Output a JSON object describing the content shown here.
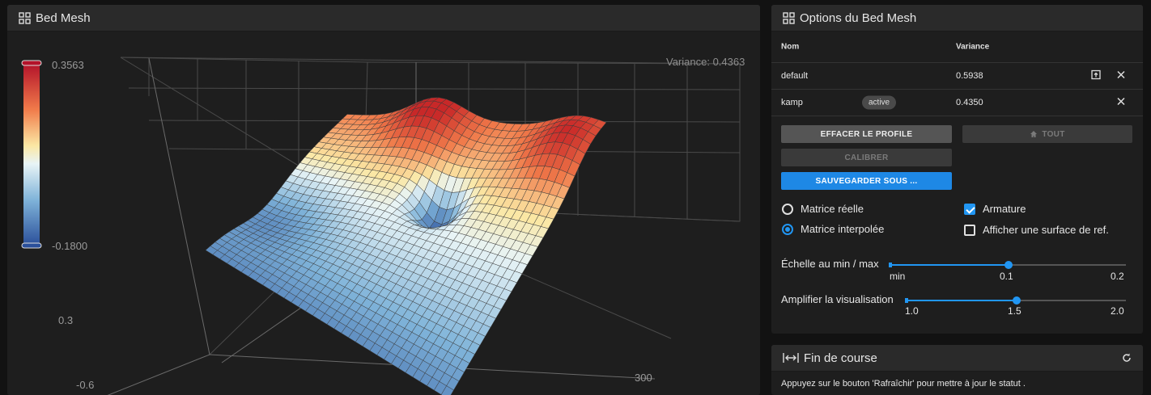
{
  "left_panel": {
    "title": "Bed Mesh",
    "variance": "Variance: 0.4363",
    "scale_max": "0.3563",
    "scale_min": "-0.1800",
    "axis_z_high": "0.3",
    "axis_z_low": "-0.6",
    "axis_x_end": "300"
  },
  "options": {
    "title": "Options du Bed Mesh",
    "col_name": "Nom",
    "col_variance": "Variance",
    "profiles": [
      {
        "name": "default",
        "badge": "",
        "variance": "0.5938"
      },
      {
        "name": "kamp",
        "badge": "active",
        "variance": "0.4350"
      }
    ],
    "btn_clear": "EFFACER LE PROFILE",
    "btn_home": "TOUT",
    "btn_calibrate": "CALIBRER",
    "btn_save": "SAUVEGARDER SOUS ...",
    "radio_real": "Matrice réelle",
    "radio_interp": "Matrice interpolée",
    "cb_wireframe": "Armature",
    "cb_refsurface": "Afficher une surface de ref.",
    "scale_label": "Échelle au min / max",
    "scale_ticks": [
      "min",
      "0.1",
      "0.2"
    ],
    "scale_value": 0.1,
    "amp_label": "Amplifier la visualisation",
    "amp_ticks": [
      "1.0",
      "1.5",
      "2.0"
    ],
    "amp_value": 1.5
  },
  "endstops": {
    "title": "Fin de course",
    "message": "Appuyez sur le bouton 'Rafraîchir' pour mettre à jour le statut ."
  }
}
